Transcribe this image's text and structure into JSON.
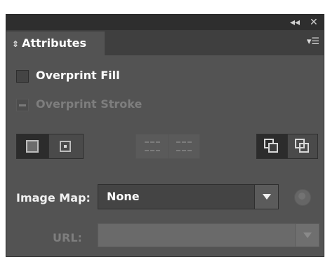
{
  "panel": {
    "title": "Attributes",
    "tab_arrows_glyph": "⇕",
    "collapse_icon_glyph": "◂◂",
    "close_icon_glyph": "✕",
    "panel_menu_glyph": "▾☰"
  },
  "options": {
    "overprint_fill": {
      "label": "Overprint Fill",
      "checked": false
    },
    "overprint_stroke": {
      "label": "Overprint Stroke",
      "state": "mixed",
      "enabled": false
    }
  },
  "toolbar": {
    "group1": [
      "dont-show-center-icon",
      "show-center-icon"
    ],
    "group2": [
      "reverse-path-direction-off-icon",
      "reverse-path-direction-on-icon"
    ],
    "group3": [
      "use-non-zero-winding-fill-icon",
      "use-even-odd-fill-icon"
    ]
  },
  "image_map": {
    "label": "Image Map:",
    "value": "None"
  },
  "url": {
    "label": "URL:",
    "value": ""
  },
  "colors": {
    "panel_bg": "#535353",
    "titlebar_bg": "#2e2e2e",
    "text": "#ffffff",
    "disabled_text": "#7e7e7e"
  }
}
